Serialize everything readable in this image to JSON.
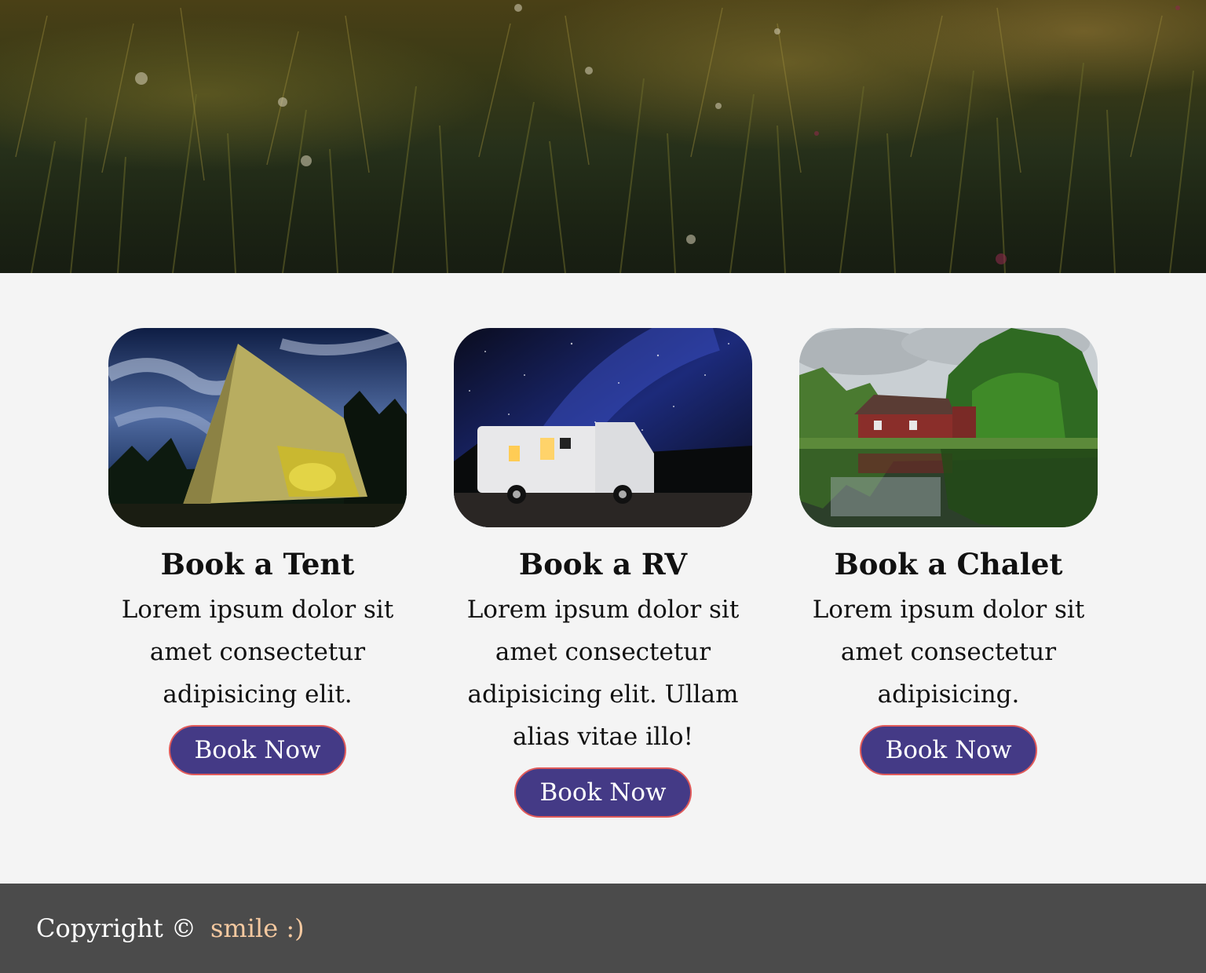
{
  "cards": [
    {
      "title": "Book a Tent",
      "text": "Lorem ipsum dolor sit amet consectetur adipisicing elit.",
      "button": "Book Now",
      "image_icon": "tent-photo"
    },
    {
      "title": "Book a RV",
      "text": "Lorem ipsum dolor sit amet consectetur adipisicing elit. Ullam alias vitae illo!",
      "button": "Book Now",
      "image_icon": "rv-photo"
    },
    {
      "title": "Book a Chalet",
      "text": "Lorem ipsum dolor sit amet consectetur adipisicing.",
      "button": "Book Now",
      "image_icon": "chalet-photo"
    }
  ],
  "footer": {
    "copyright": "Copyright ©",
    "accent": "smile :)"
  },
  "colors": {
    "button_bg": "#443a86",
    "button_border": "#e05a5a",
    "footer_bg": "#4b4b4b",
    "accent_text": "#f5c9a0",
    "section_bg": "#f4f4f4"
  }
}
